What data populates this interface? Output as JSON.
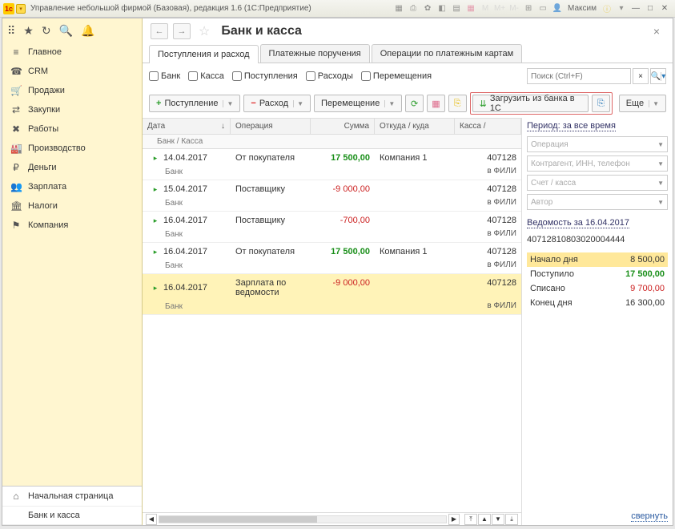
{
  "titlebar": {
    "title": "Управление небольшой фирмой (Базовая), редакция 1.6  (1С:Предприятие)",
    "user": "Максим"
  },
  "sidebar": {
    "items": [
      {
        "icon": "≡",
        "label": "Главное"
      },
      {
        "icon": "☎",
        "label": "CRM"
      },
      {
        "icon": "🛒",
        "label": "Продажи"
      },
      {
        "icon": "⇄",
        "label": "Закупки"
      },
      {
        "icon": "✖",
        "label": "Работы"
      },
      {
        "icon": "🏭",
        "label": "Производство"
      },
      {
        "icon": "₽",
        "label": "Деньги"
      },
      {
        "icon": "👥",
        "label": "Зарплата"
      },
      {
        "icon": "🏛",
        "label": "Налоги"
      },
      {
        "icon": "⚑",
        "label": "Компания"
      }
    ],
    "bottom": [
      {
        "icon": "⌂",
        "label": "Начальная страница"
      },
      {
        "icon": "",
        "label": "Банк и касса"
      }
    ]
  },
  "page": {
    "title": "Банк и касса",
    "tabs": [
      "Поступления и расход",
      "Платежные поручения",
      "Операции по платежным картам"
    ],
    "filters": {
      "bank": "Банк",
      "kassa": "Касса",
      "income": "Поступления",
      "expense": "Расходы",
      "move": "Перемещения",
      "search_placeholder": "Поиск (Ctrl+F)"
    },
    "toolbar": {
      "income": "Поступление",
      "expense": "Расход",
      "move": "Перемещение",
      "load": "Загрузить из банка в 1С",
      "more": "Еще"
    },
    "columns": {
      "date": "Дата",
      "op": "Операция",
      "sum": "Сумма",
      "where": "Откуда / куда",
      "acc": "Касса /",
      "sub_date": "Банк / Касса"
    },
    "rows": [
      {
        "date": "14.04.2017",
        "sub": "Банк",
        "op": "От покупателя",
        "sum": "17 500,00",
        "pos": true,
        "where": "Компания 1",
        "acc": "407128",
        "acc2": "в ФИЛИ"
      },
      {
        "date": "15.04.2017",
        "sub": "Банк",
        "op": "Поставщику",
        "sum": "-9 000,00",
        "pos": false,
        "where": "",
        "acc": "407128",
        "acc2": "в ФИЛИ"
      },
      {
        "date": "16.04.2017",
        "sub": "Банк",
        "op": "Поставщику",
        "sum": "-700,00",
        "pos": false,
        "where": "",
        "acc": "407128",
        "acc2": "в ФИЛИ"
      },
      {
        "date": "16.04.2017",
        "sub": "Банк",
        "op": "От покупателя",
        "sum": "17 500,00",
        "pos": true,
        "where": "Компания 1",
        "acc": "407128",
        "acc2": "в ФИЛИ"
      },
      {
        "date": "16.04.2017",
        "sub": "Банк",
        "op": "Зарплата по ведомости",
        "sum": "-9 000,00",
        "pos": false,
        "where": "",
        "acc": "407128",
        "acc2": "в ФИЛИ",
        "sel": true
      }
    ],
    "side": {
      "period": "Период: за все время",
      "f1": "Операция",
      "f2": "Контрагент, ИНН, телефон",
      "f3": "Счет / касса",
      "f4": "Автор",
      "vedom": "Ведомость за 16.04.2017",
      "account": "40712810803020004444",
      "summary": [
        {
          "l": "Начало дня",
          "v": "8 500,00",
          "cls": ""
        },
        {
          "l": "Поступило",
          "v": "17 500,00",
          "cls": "pos"
        },
        {
          "l": "Списано",
          "v": "9 700,00",
          "cls": "neg"
        },
        {
          "l": "Конец дня",
          "v": "16 300,00",
          "cls": ""
        }
      ],
      "collapse": "свернуть"
    }
  }
}
